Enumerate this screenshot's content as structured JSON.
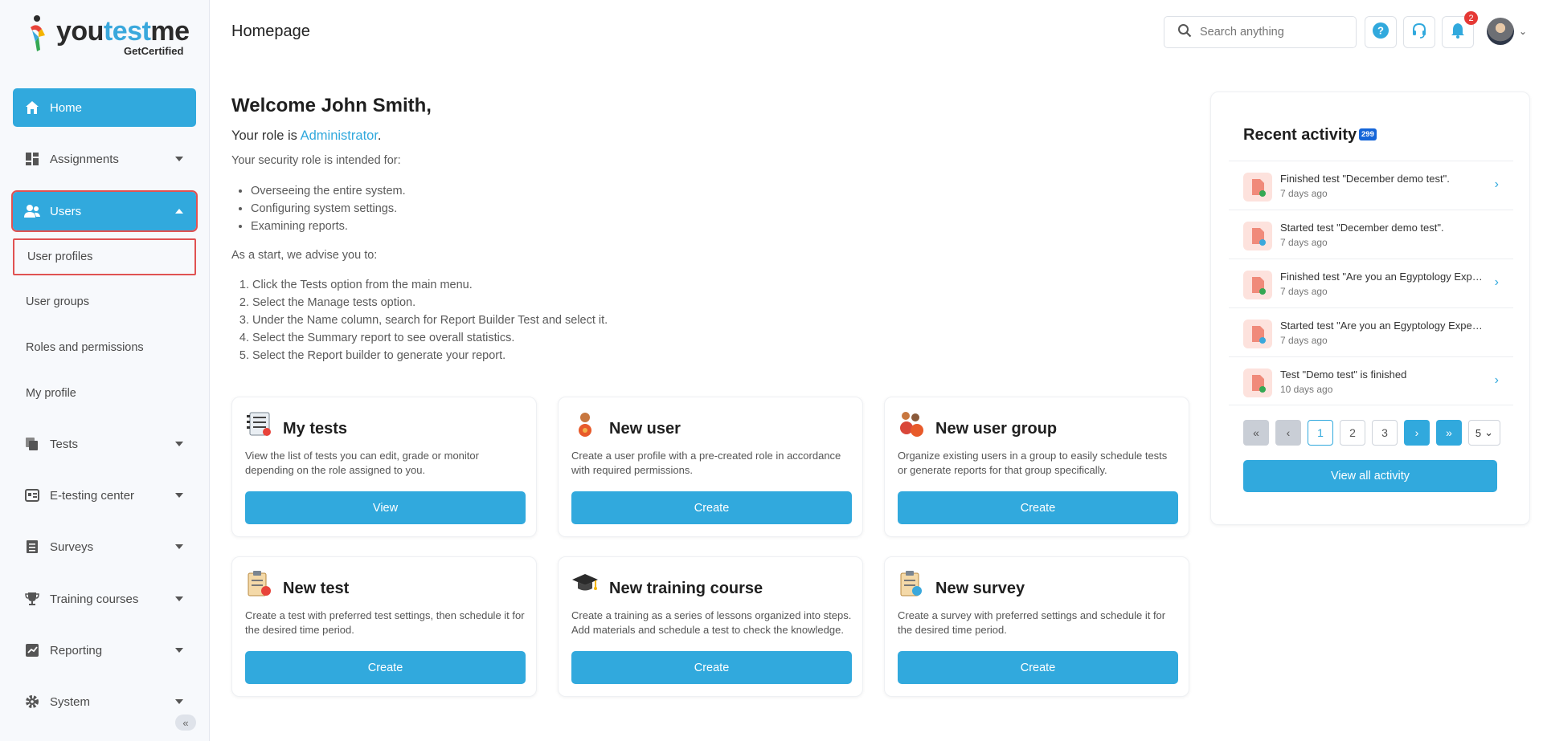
{
  "brand": {
    "name_a": "you",
    "name_b": "test",
    "name_c": "me",
    "tagline": "GetCertified"
  },
  "header": {
    "title": "Homepage",
    "search_placeholder": "Search anything",
    "notifications_count": "2"
  },
  "sidebar": {
    "items": [
      {
        "label": "Home",
        "icon": "home-icon"
      },
      {
        "label": "Assignments",
        "icon": "dashboard-icon"
      },
      {
        "label": "Users",
        "icon": "users-icon"
      },
      {
        "label": "Tests",
        "icon": "copy-icon"
      },
      {
        "label": "E-testing center",
        "icon": "id-card-icon"
      },
      {
        "label": "Surveys",
        "icon": "list-icon"
      },
      {
        "label": "Training courses",
        "icon": "trophy-icon"
      },
      {
        "label": "Reporting",
        "icon": "chart-icon"
      },
      {
        "label": "System",
        "icon": "gear-icon"
      }
    ],
    "users_sub": [
      "User profiles",
      "User groups",
      "Roles and permissions",
      "My profile"
    ],
    "collapse_label": "«"
  },
  "welcome": {
    "title": "Welcome John Smith,",
    "role_prefix": "Your role is ",
    "role": "Administrator",
    "role_suffix": ".",
    "intended": "Your security role is intended for:",
    "bullets": [
      "Overseeing the entire system.",
      "Configuring system settings.",
      "Examining reports."
    ],
    "advise": "As a start, we advise you to:",
    "steps": [
      "Click the Tests option from the main menu.",
      "Select the Manage tests option.",
      "Under the Name column, search for Report Builder Test and select it.",
      "Select the Summary report to see overall statistics.",
      "Select the Report builder to generate your report."
    ]
  },
  "cards": [
    {
      "title": "My tests",
      "desc": "View the list of tests you can edit, grade or monitor depending on the role assigned to you.",
      "button": "View"
    },
    {
      "title": "New user",
      "desc": "Create a user profile with a pre-created role in accordance with required permissions.",
      "button": "Create"
    },
    {
      "title": "New user group",
      "desc": "Organize existing users in a group to easily schedule tests or generate reports for that group specifically.",
      "button": "Create"
    },
    {
      "title": "New test",
      "desc": "Create a test with preferred test settings, then schedule it for the desired time period.",
      "button": "Create"
    },
    {
      "title": "New training course",
      "desc": "Create a training as a series of lessons organized into steps. Add materials and schedule a test to check the knowledge.",
      "button": "Create"
    },
    {
      "title": "New survey",
      "desc": "Create a survey with preferred settings and schedule it for the desired time period.",
      "button": "Create"
    }
  ],
  "activity": {
    "title": "Recent activity",
    "count": "299",
    "rows": [
      {
        "text": "Finished test \"December demo test\".",
        "time": "7 days ago",
        "status": "finished"
      },
      {
        "text": "Started test \"December demo test\".",
        "time": "7 days ago",
        "status": "started"
      },
      {
        "text": "Finished test \"Are you an Egyptology Expert?\".",
        "time": "7 days ago",
        "status": "finished"
      },
      {
        "text": "Started test \"Are you an Egyptology Expert?\".",
        "time": "7 days ago",
        "status": "started"
      },
      {
        "text": "Test \"Demo test\" is finished",
        "time": "10 days ago",
        "status": "finished"
      }
    ],
    "pages": [
      "1",
      "2",
      "3"
    ],
    "page_size": "5",
    "view_all": "View all activity"
  },
  "colors": {
    "accent": "#31a9dd",
    "highlight_outline": "#e05252",
    "count_badge": "#1565d8",
    "notification_badge": "#e53935"
  }
}
